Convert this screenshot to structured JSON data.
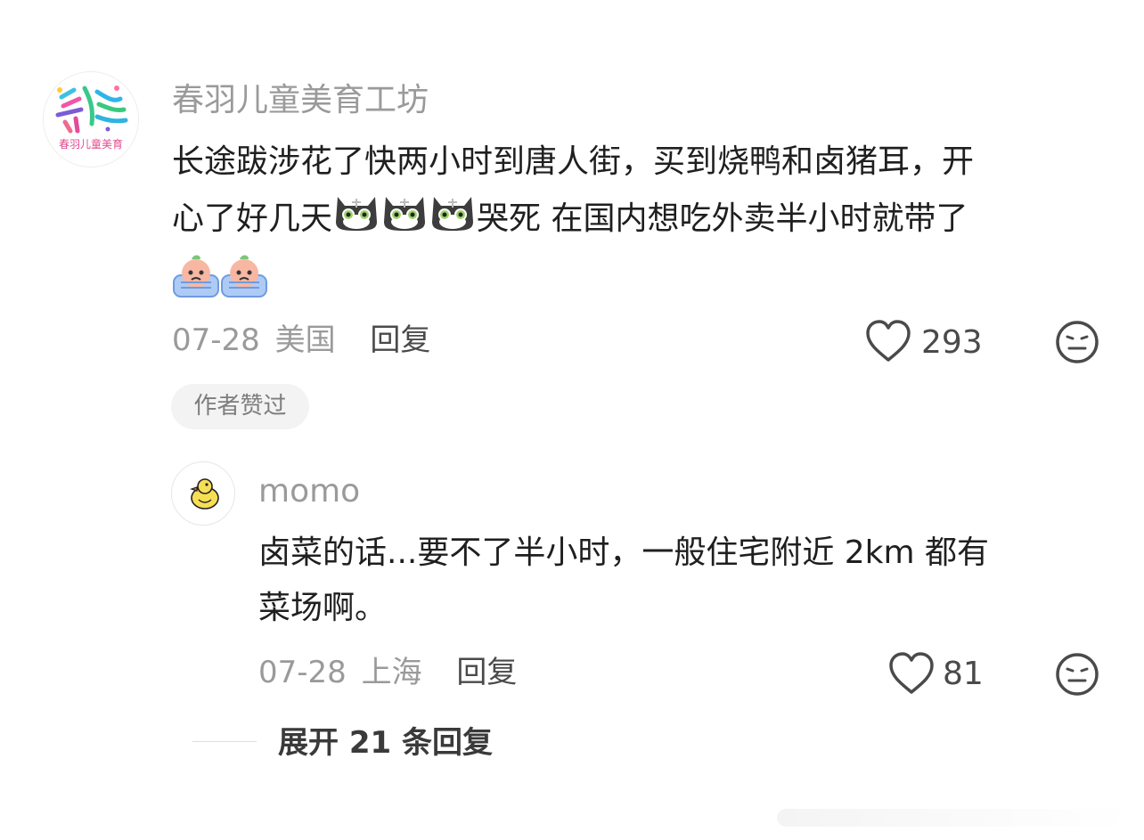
{
  "comment": {
    "username": "春羽儿童美育工坊",
    "avatar_text": "春羽儿童美育",
    "text_line1": "长途跋涉花了快两小时到唐人街，买到烧鸭和卤猪耳，开",
    "text_line2_before": "心了好几天",
    "text_line2_after": "哭死 在国内想吃外卖半小时就带了",
    "emoji_cat": "cat-emoji",
    "emoji_cry": "crying-emoji",
    "date": "07-28",
    "location": "美国",
    "reply_label": "回复",
    "likes": "293",
    "author_liked": "作者赞过"
  },
  "reply": {
    "username": "momo",
    "avatar_icon": "duck-icon",
    "text_line1": "卤菜的话...要不了半小时，一般住宅附近 2km 都有",
    "text_line2": "菜场啊。",
    "date": "07-28",
    "location": "上海",
    "reply_label": "回复",
    "likes": "81"
  },
  "expand": {
    "label": "展开 21 条回复"
  },
  "colors": {
    "muted": "#9a9a9a",
    "text": "#1f1f1f",
    "pill": "#f3f3f3"
  }
}
